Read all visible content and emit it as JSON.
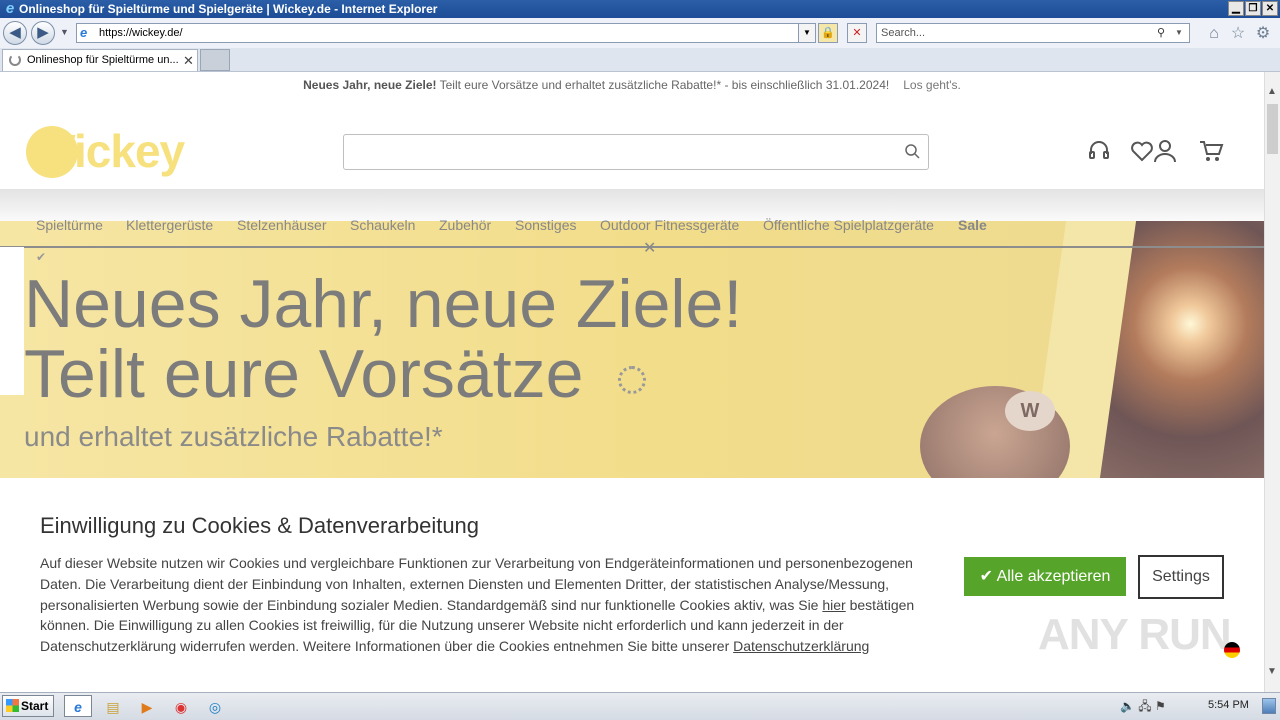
{
  "window": {
    "title": "Onlineshop für Spieltürme und Spielgeräte | Wickey.de - Internet Explorer",
    "buttons": {
      "minimize": "▁",
      "restore": "❐",
      "close": "✕"
    }
  },
  "browser": {
    "back": "◀",
    "forward": "▶",
    "address": "https://wickey.de/",
    "search_placeholder": "Search...",
    "tab_title": "Onlineshop für Spieltürme un...",
    "tab_close": "✕",
    "icons": [
      "home-icon",
      "favorites-star-icon",
      "settings-gear-icon"
    ]
  },
  "site": {
    "promo_bold": "Neues Jahr, neue Ziele!",
    "promo_text": " Teilt eure Vorsätze und erhaltet zusätzliche Rabatte!* - bis einschließlich 31.01.2024!",
    "promo_link": "Los geht's.",
    "logo_text": "Wickey",
    "nav": [
      "Spieltürme",
      "Klettergerüste",
      "Stelzenhäuser",
      "Schaukeln",
      "Zubehör",
      "Sonstiges",
      "Outdoor Fitnessgeräte",
      "Öffentliche Spielplatzgeräte",
      "Sale"
    ],
    "hero": {
      "line1": "Neues Jahr, neue Ziele!",
      "line2": "Teilt eure Vorsätze",
      "sub": "und erhaltet zusätzliche Rabatte!*",
      "badge": "W"
    }
  },
  "cookie": {
    "title": "Einwilligung zu Cookies & Datenverarbeitung",
    "text_1": "Auf dieser Website nutzen wir Cookies und vergleichbare Funktionen zur Verarbeitung von Endgeräteinformationen und personenbezogenen Daten. Die Verarbeitung dient der Einbindung von Inhalten, externen Diensten und Elementen Dritter, der statistischen Analyse/Messung, personalisierten Werbung sowie der Einbindung sozialer Medien. Standardgemäß sind nur funktionelle Cookies aktiv, was Sie ",
    "link_here": "hier",
    "text_2": " bestätigen können. Die Einwilligung zu allen Cookies ist freiwillig, für die Nutzung unserer Website nicht erforderlich und kann jederzeit in der Datenschutzerklärung widerrufen werden. Weitere Informationen über die Cookies entnehmen Sie bitte unserer ",
    "link_privacy": "Datenschutzerklärung",
    "accept": "Alle akzeptieren",
    "settings": "Settings"
  },
  "watermark": "ANY RUN",
  "taskbar": {
    "start": "Start",
    "time": "5:54 PM"
  },
  "colors": {
    "accent_green": "#56a52a",
    "logo_yellow": "#f6e17e",
    "hero_bg": "#f4e29a",
    "title_bar": "#1c4d96"
  }
}
